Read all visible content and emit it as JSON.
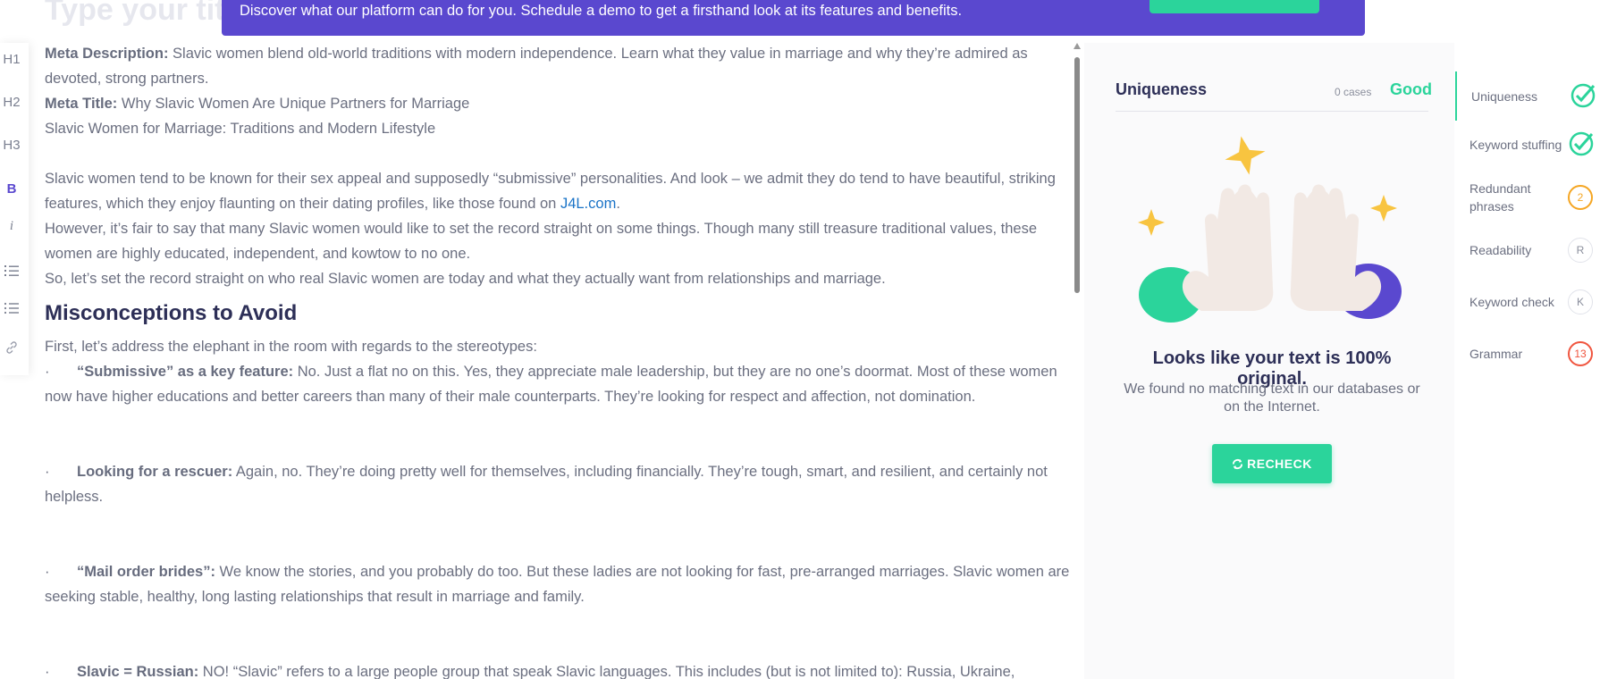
{
  "editor": {
    "title_placeholder": "Type your title",
    "meta_description_label": "Meta Description:",
    "meta_description": " Slavic women blend old-world traditions with modern independence. Learn what they value in marriage and why they’re admired as devoted, strong partners.",
    "meta_title_label": "Meta Title:",
    "meta_title": " Why Slavic Women Are Unique Partners for Marriage",
    "subtitle": "Slavic Women for Marriage: Traditions and Modern Lifestyle",
    "para1_before_link": "Slavic women tend to be known for their sex appeal and supposedly “submissive” personalities. And look – we admit they do tend to have beautiful, striking features, which they enjoy flaunting on their dating profiles, like those found on ",
    "para1_link": "J4L.com",
    "para1_after_link": ".",
    "para2": "However, it’s fair to say that many Slavic women would like to set the record straight on some things. Though many still treasure traditional values, these women are highly educated, independent, and kowtow to no one.",
    "para3": "So, let’s set the record straight on who real Slavic women are today and what they actually want from relationships and marriage.",
    "heading": "Misconceptions to Avoid",
    "intro": "First, let’s address the elephant in the room with regards to the stereotypes:",
    "bullet_char": "·",
    "bullets": [
      {
        "label": "“Submissive” as a key feature:",
        "text": " No. Just a flat no on this. Yes, they appreciate male leadership, but they are no one’s doormat. Most of these women now have higher educations and better careers than many of their male counterparts. They’re looking for respect and affection, not domination."
      },
      {
        "label": "Looking for a rescuer:",
        "text": " Again, no. They’re doing pretty well for themselves, including financially. They’re tough, smart, and resilient, and certainly not helpless."
      },
      {
        "label": "“Mail order brides”:",
        "text": " We know the stories, and you probably do too. But these ladies are not looking for fast, pre-arranged marriages. Slavic women are seeking stable, healthy, long lasting relationships that result in marriage and family."
      },
      {
        "label": "Slavic = Russian:",
        "text": " NO! “Slavic” refers to a large people group that speak Slavic languages. This includes (but is not limited to): Russia, Ukraine, Balkans, and"
      }
    ]
  },
  "banner": {
    "text": "Discover what our platform can do for you. Schedule a demo to get a firsthand look at its features and benefits."
  },
  "toolbar": {
    "h1": "H1",
    "h2": "H2",
    "h3": "H3",
    "bold": "B",
    "italic": "i"
  },
  "panel": {
    "title": "Uniqueness",
    "cases": "0 cases",
    "status": "Good",
    "result_title": "Looks like your text is 100% original.",
    "result_sub": "We found no matching text in our databases or on the Internet.",
    "recheck_label": "RECHECK"
  },
  "checks": {
    "uniqueness": "Uniqueness",
    "keyword_stuffing": "Keyword stuffing",
    "redundant_phrases": "Redundant phrases",
    "redundant_count": "2",
    "readability": "Readability",
    "readability_badge": "R",
    "keyword_check": "Keyword check",
    "keyword_badge": "K",
    "grammar": "Grammar",
    "grammar_count": "13"
  },
  "colors": {
    "accent_green": "#2bd49b",
    "banner_purple": "#5a48cf",
    "heading_navy": "#2d2f57",
    "link_blue": "#1a73c7",
    "warning_orange": "#f5a623",
    "error_red": "#f0553f"
  }
}
